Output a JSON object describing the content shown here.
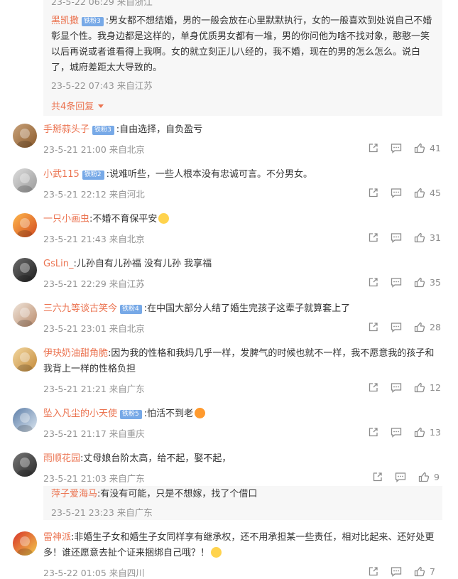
{
  "top_reply": {
    "partial_meta": "23-5-22 06:29 来自浙江",
    "name": "黑凯撒",
    "badge": "铁粉3",
    "text_line1": ":男女都不想结婚，男的一般会放在心里默默执行，女的一般喜欢到处说自己不婚",
    "text_line2": "彰显个性。我身边都是这样的，单身优质男女都有一堆，男的你问他为啥不找对象，憨憨一笑",
    "text_line3": "以后再说或者谁看得上我啊。女的就立刻正儿八经的，我不婚，现在的男的怎么怎么。说白",
    "text_line4": "了，城府差距太大导致的。",
    "meta": "23-5-22 07:43 来自江苏",
    "more_replies": "共4条回复"
  },
  "comments": [
    {
      "name": "手掰蒜头子",
      "badge": "铁粉3",
      "text": ":自由选择，自负盈亏",
      "meta": "23-5-21 21:00 来自北京",
      "likes": "41"
    },
    {
      "name": "小武115",
      "badge": "铁粉2",
      "text": ":说难听些，一些人根本没有忠诚可言。不分男女。",
      "meta": "23-5-21 22:12 来自河北",
      "likes": "45"
    },
    {
      "name": "一只小画虫",
      "badge": "",
      "text": ":不婚不育保平安",
      "meta": "23-5-21 21:43 来自北京",
      "likes": "31"
    },
    {
      "name": "GsLin_",
      "badge": "",
      "text": ":儿孙自有儿孙福 没有儿孙 我享福",
      "meta": "23-5-21 22:29 来自江苏",
      "likes": "35"
    },
    {
      "name": "三六九等谈古笑今",
      "badge": "铁粉4",
      "text": ":在中国大部分人结了婚生完孩子这辈子就算套上了",
      "meta": "23-5-21 23:01 来自北京",
      "likes": "28"
    },
    {
      "name": "伊玦奶油甜角脆",
      "badge": "",
      "text": ":因为我的性格和我妈几乎一样，发脾气的时候也就不一样，我不愿意我的孩子和",
      "text2": "我背上一样的性格负担",
      "meta": "23-5-21 21:21 来自广东",
      "likes": "12"
    },
    {
      "name": "坠入凡尘的小天使",
      "badge": "铁粉5",
      "text": ":怕活不到老",
      "meta": "23-5-21 21:17 来自重庆",
      "likes": "13"
    },
    {
      "name": "雨顺花园",
      "badge": "",
      "text": ":丈母娘台阶太高，给不起，娶不起，",
      "meta": "23-5-21 21:03 来自广东",
      "likes": "9"
    },
    {
      "name": "雷神派",
      "badge": "",
      "text": ":非婚生子女和婚生子女同样享有继承权，还不用承担某一些责任，相对比起来、还好处更",
      "text2": "多！谁还愿意去扯个证来捆绑自己哦？！",
      "meta": "23-5-22 01:05 来自四川",
      "likes": "7"
    }
  ],
  "nested_reply": {
    "name": "萍子爱海马",
    "text": ":有没有可能，只是不想嫁，找了个借口",
    "meta": "23-5-21 23:23 来自广东"
  }
}
